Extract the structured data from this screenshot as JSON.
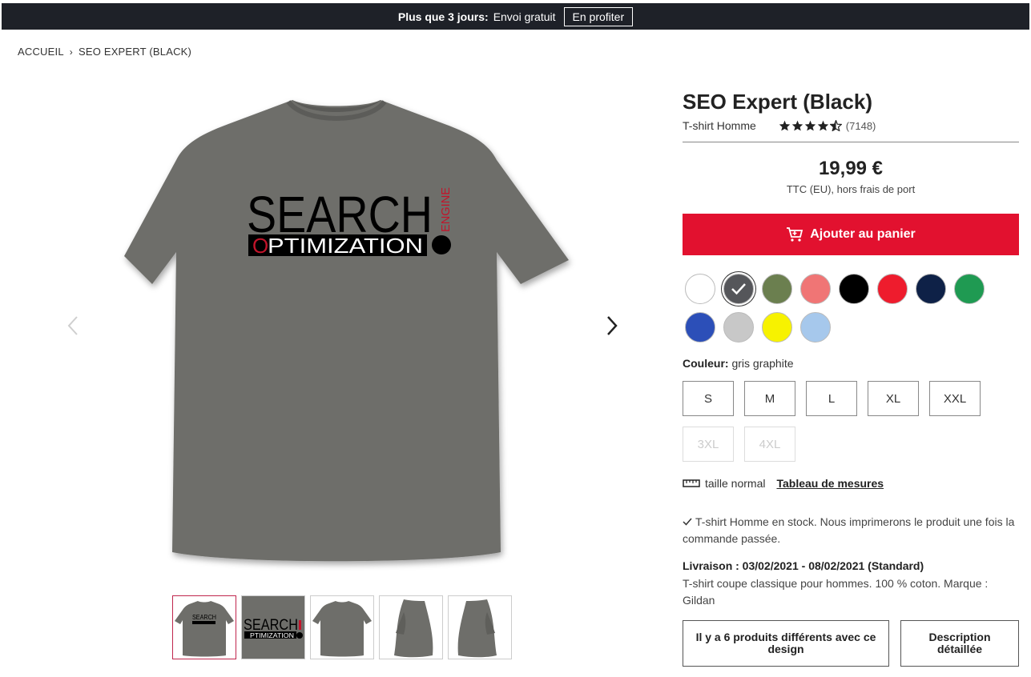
{
  "promo": {
    "bold_text": "Plus que 3 jours:",
    "offer_text": "Envoi gratuit",
    "cta_label": "En profiter"
  },
  "breadcrumb": {
    "home": "ACCUEIL",
    "separator": "›",
    "current": "SEO EXPERT (BLACK)"
  },
  "artwork": {
    "line1": "SEARCH",
    "line1_side": "ENGINE",
    "line2": "PTIMIZATION",
    "line2_first": "O"
  },
  "product": {
    "title": "SEO Expert (Black)",
    "type": "T-shirt Homme",
    "rating_stars": 4.5,
    "rating_count": "(7148)",
    "price": "19,99 €",
    "price_note": "TTC (EU), hors frais de port",
    "add_to_cart": "Ajouter au panier"
  },
  "colors": {
    "selected_index": 1,
    "label_key": "Couleur:",
    "label_value": "gris graphite",
    "swatches": [
      "#ffffff",
      "#55565a",
      "#6b7f4f",
      "#f07575",
      "#000000",
      "#ee1c2d",
      "#0e2147",
      "#1f9a52",
      "#2c4fb8",
      "#c8c8c8",
      "#f7f200",
      "#a6c8ec"
    ]
  },
  "sizes": {
    "available": [
      "S",
      "M",
      "L",
      "XL",
      "XXL"
    ],
    "unavailable": [
      "3XL",
      "4XL"
    ]
  },
  "fit": {
    "label": "taille normal",
    "size_chart_link": "Tableau de mesures"
  },
  "stock_text": "T-shirt Homme en stock. Nous imprimerons le produit une fois la commande passée.",
  "delivery_text": "Livraison : 03/02/2021 - 08/02/2021 (Standard)",
  "description_text": "T-shirt coupe classique pour hommes. 100 % coton. Marque : Gildan",
  "buttons": {
    "variants": "Il y a 6 produits différents avec ce design",
    "details": "Description détaillée"
  },
  "theme": {
    "promo_bg": "#1e2128",
    "cta_red": "#e2112f",
    "shirt_color": "#6e6e6a",
    "active_thumb_border": "#c0264d"
  }
}
